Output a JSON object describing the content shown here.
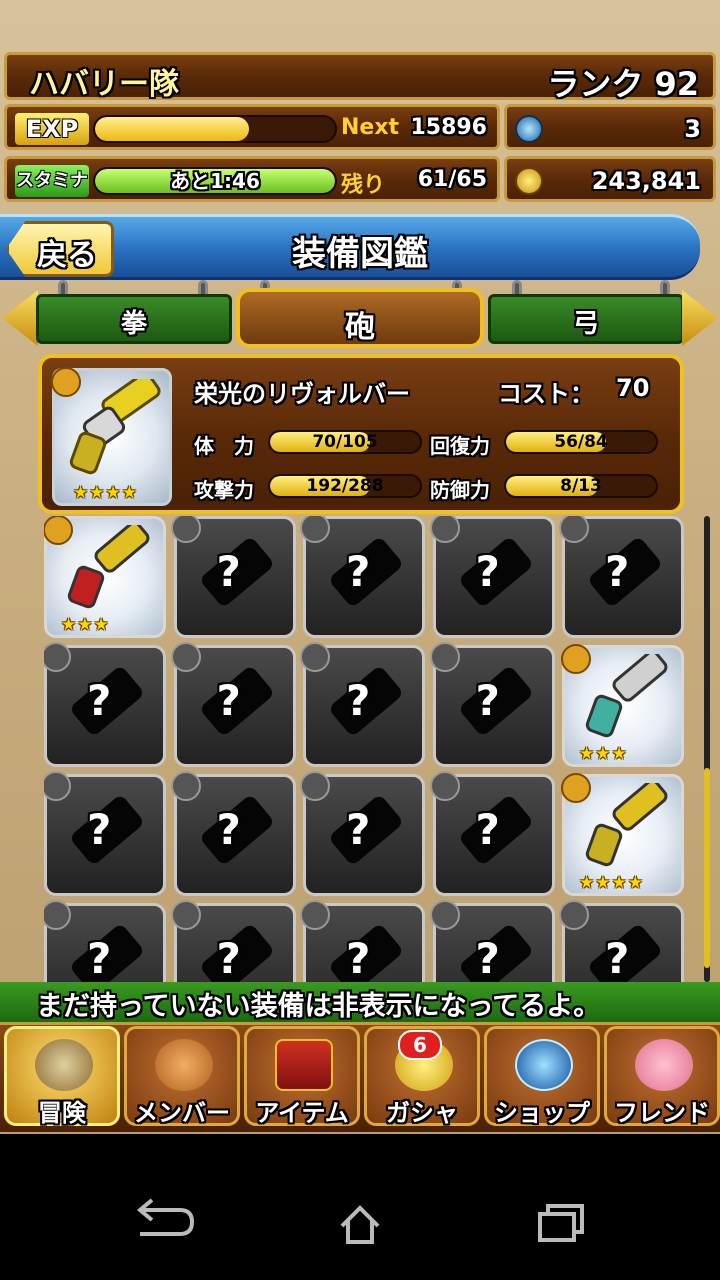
{
  "header": {
    "team_name": "ハバリー隊",
    "rank": "ランク 92",
    "exp": {
      "label": "EXP",
      "fill_fraction": 0.64,
      "key": "Next",
      "value": "15896"
    },
    "stamina": {
      "label": "スタミナ",
      "fill_fraction": 1.0,
      "bar_text": "あと1:46",
      "key": "残り",
      "value": "61/65"
    },
    "gems": {
      "icon": "orb-icon",
      "value": "3"
    },
    "coins": {
      "icon": "coin-icon",
      "value": "243,841"
    }
  },
  "title_bar": {
    "back_label": "戻る",
    "title": "装備図鑑"
  },
  "tabs": [
    {
      "label": "拳",
      "active": false
    },
    {
      "label": "砲",
      "active": true
    },
    {
      "label": "弓",
      "active": false
    }
  ],
  "detail": {
    "name": "栄光のリヴォルバー",
    "cost_label": "コスト：",
    "cost_value": "70",
    "stars": "★★★★",
    "stats": [
      {
        "label": "体　力",
        "text": "70/105",
        "fraction": 0.667
      },
      {
        "label": "回復力",
        "text": "56/84",
        "fraction": 0.667
      },
      {
        "label": "攻撃力",
        "text": "192/288",
        "fraction": 0.667
      },
      {
        "label": "防御力",
        "text": "8/13",
        "fraction": 0.615
      }
    ]
  },
  "grid": {
    "locked_mark": "?",
    "cells": [
      {
        "owned": true,
        "stars": "★★★"
      },
      {
        "owned": false
      },
      {
        "owned": false
      },
      {
        "owned": false
      },
      {
        "owned": false
      },
      {
        "owned": false
      },
      {
        "owned": false
      },
      {
        "owned": false
      },
      {
        "owned": false
      },
      {
        "owned": true,
        "stars": "★★★"
      },
      {
        "owned": false
      },
      {
        "owned": false
      },
      {
        "owned": false
      },
      {
        "owned": false
      },
      {
        "owned": true,
        "stars": "★★★★"
      },
      {
        "owned": false
      },
      {
        "owned": false
      },
      {
        "owned": false
      },
      {
        "owned": false
      },
      {
        "owned": false
      }
    ]
  },
  "notice": "まだ持っていない装備は非表示になってるよ。",
  "bottom_nav": [
    {
      "label": "冒険",
      "icon": "backpack-icon"
    },
    {
      "label": "メンバー",
      "icon": "paw-icon"
    },
    {
      "label": "アイテム",
      "icon": "treasure-chest-icon"
    },
    {
      "label": "ガシャ",
      "icon": "capsule-machine-icon",
      "badge": "6"
    },
    {
      "label": "ショップ",
      "icon": "crystal-orb-icon"
    },
    {
      "label": "フレンド",
      "icon": "friends-icon"
    }
  ],
  "colors": {
    "accent_gold": "#f0c020",
    "title_blue": "#2870c0",
    "wood": "#5a2a08",
    "notice_green": "#1d6a10"
  }
}
